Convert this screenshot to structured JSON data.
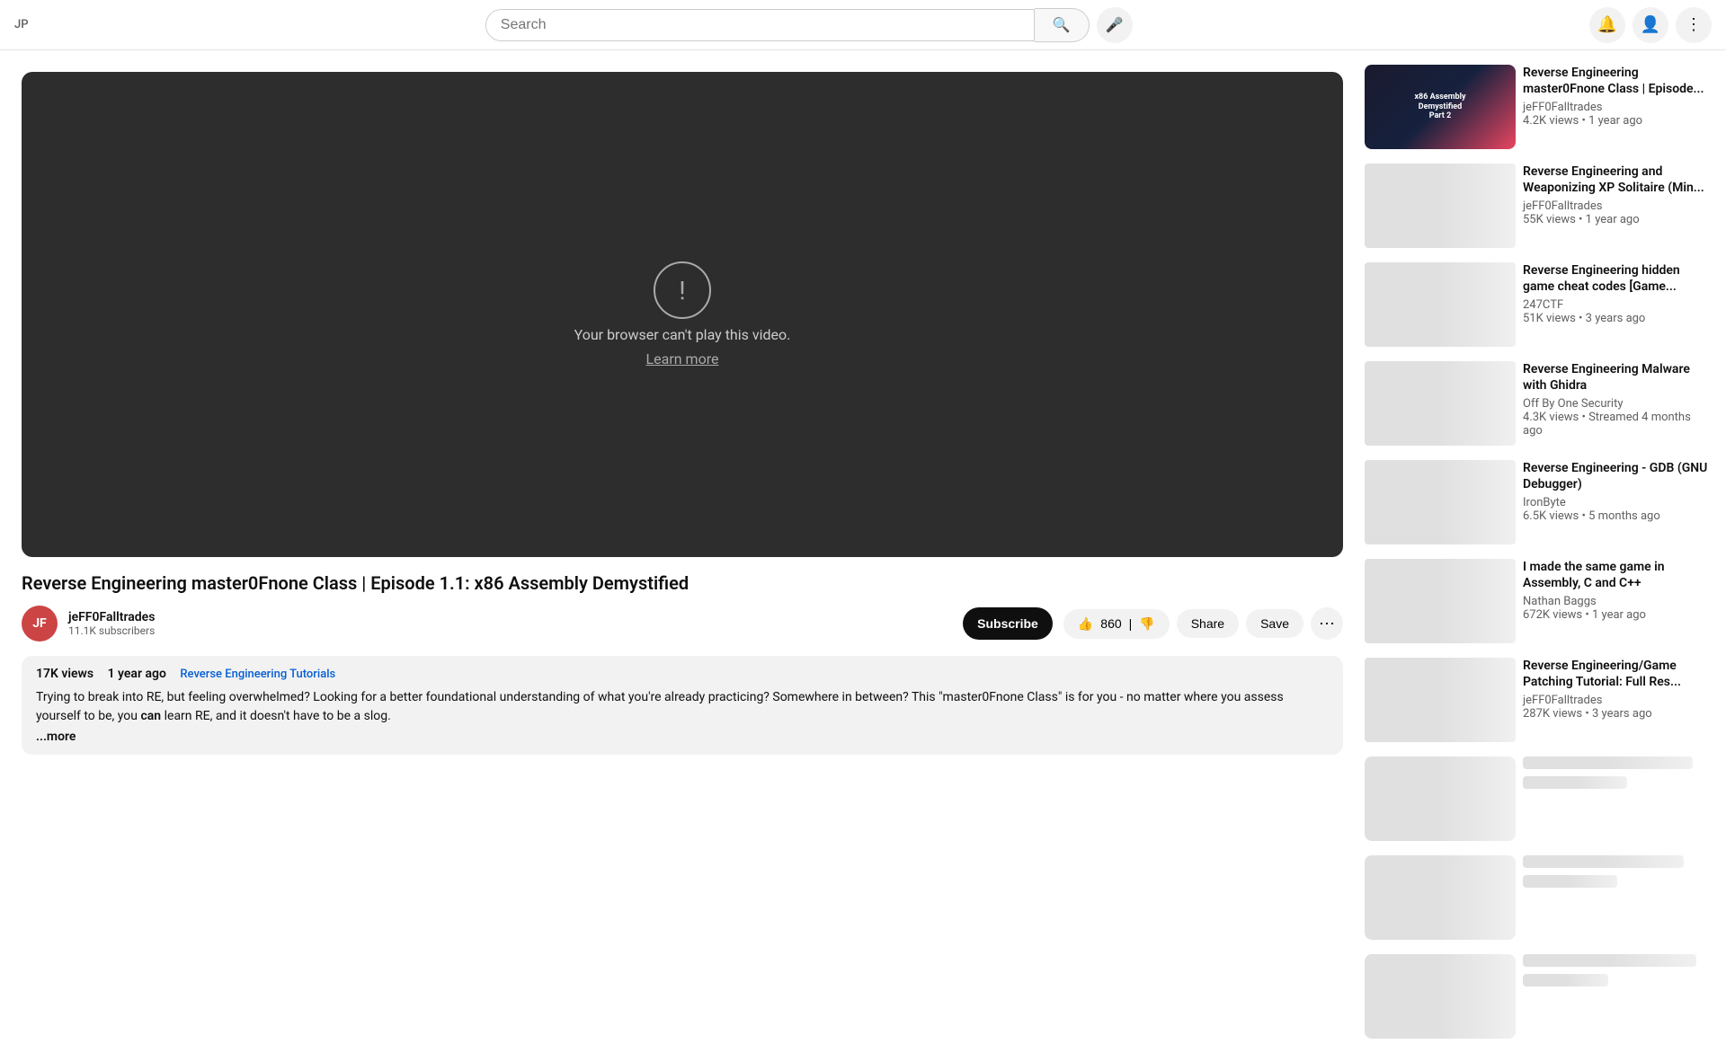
{
  "header": {
    "logo": "JP",
    "search_placeholder": "Search",
    "search_value": "",
    "mic_icon": "🎤",
    "icons": [
      "🔔",
      "👤",
      "⋮"
    ]
  },
  "video": {
    "error_message": "Your browser can't play this video.",
    "learn_more": "Learn more",
    "title": "Reverse Engineering master0Fnone Class | Episode 1.1: x86 Assembly Demystified",
    "channel": {
      "name": "jeFF0Falltrades",
      "subscribers": "11.1K subscribers",
      "avatar_text": "JF"
    },
    "likes": "860",
    "share_label": "Share",
    "save_label": "Save",
    "subscribe_label": "Subscribe",
    "views": "17K views",
    "upload_date": "1 year ago",
    "category": "Reverse Engineering Tutorials",
    "description": "Trying to break into RE, but feeling overwhelmed? Looking for a better foundational understanding of what you're already practicing? Somewhere in between? This \"master0Fnone Class\" is for you - no matter where you assess yourself to be, you",
    "description_bold": "can",
    "description_end": " learn RE, and it doesn't have to be a slog.",
    "show_more": "...more"
  },
  "sidebar": {
    "videos": [
      {
        "title": "Reverse Engineering master0Fnone Class | Episode...",
        "channel": "jeFF0Falltrades",
        "views": "4.2K views",
        "age": "1 year ago",
        "has_thumb": true,
        "thumb_type": "featured"
      },
      {
        "title": "Reverse Engineering and Weaponizing XP Solitaire (Min...",
        "channel": "jeFF0Falltrades",
        "views": "55K views",
        "age": "1 year ago",
        "has_thumb": false
      },
      {
        "title": "Reverse Engineering hidden game cheat codes [Game...",
        "channel": "247CTF",
        "views": "51K views",
        "age": "3 years ago",
        "has_thumb": false
      },
      {
        "title": "Reverse Engineering Malware with Ghidra",
        "channel": "Off By One Security",
        "views": "4.3K views",
        "age": "Streamed 4 months ago",
        "has_thumb": false
      },
      {
        "title": "Reverse Engineering - GDB (GNU Debugger)",
        "channel": "IronByte",
        "views": "6.5K views",
        "age": "5 months ago",
        "has_thumb": false
      },
      {
        "title": "I made the same game in Assembly, C and C++",
        "channel": "Nathan Baggs",
        "views": "672K views",
        "age": "1 year ago",
        "has_thumb": false
      },
      {
        "title": "Reverse Engineering/Game Patching Tutorial: Full Res...",
        "channel": "jeFF0Falltrades",
        "views": "287K views",
        "age": "3 years ago",
        "has_thumb": false
      }
    ],
    "skeleton_count": 3
  }
}
